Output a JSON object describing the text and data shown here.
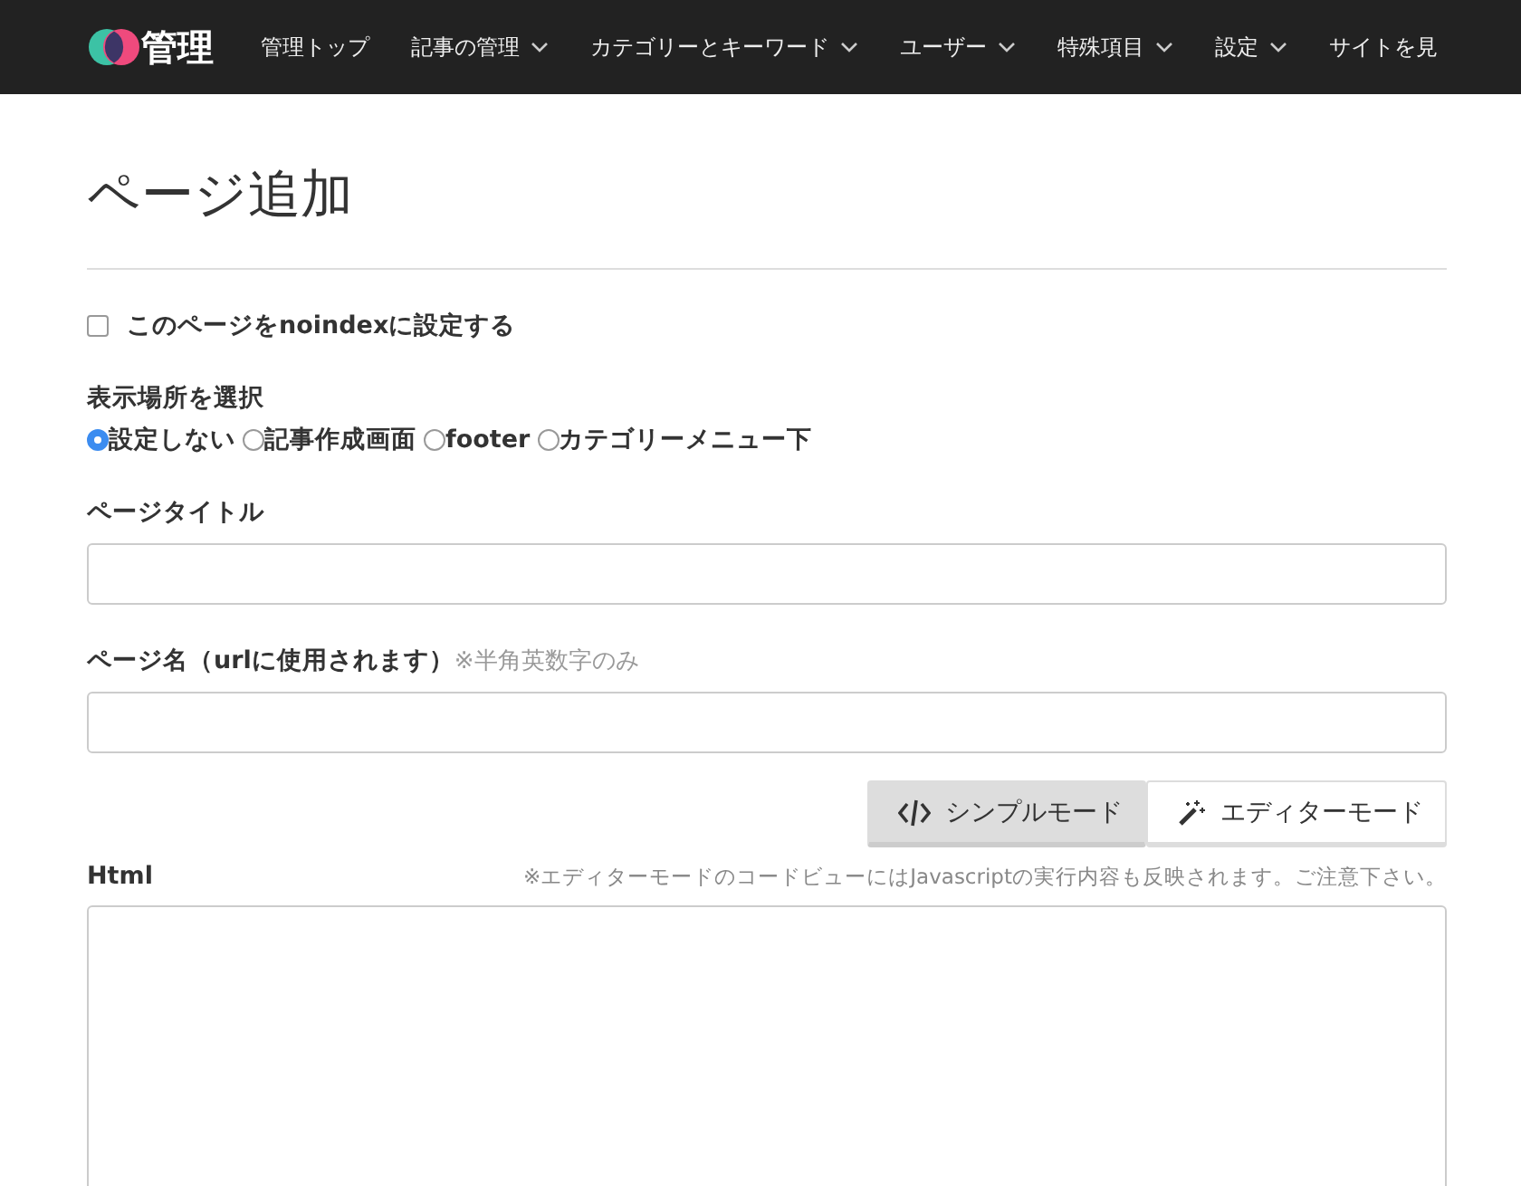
{
  "nav": {
    "logo": "管理",
    "items": [
      {
        "label": "管理トップ",
        "dropdown": false
      },
      {
        "label": "記事の管理",
        "dropdown": true
      },
      {
        "label": "カテゴリーとキーワード",
        "dropdown": true
      },
      {
        "label": "ユーザー",
        "dropdown": true
      },
      {
        "label": "特殊項目",
        "dropdown": true
      },
      {
        "label": "設定",
        "dropdown": true
      },
      {
        "label": "サイトを見",
        "dropdown": false
      }
    ]
  },
  "title": "ページ追加",
  "noindex": {
    "label": "このページをnoindexに設定する",
    "checked": false
  },
  "placement": {
    "label": "表示場所を選択",
    "options": [
      {
        "label": "設定しない",
        "selected": true
      },
      {
        "label": "記事作成画面",
        "selected": false
      },
      {
        "label": "footer",
        "selected": false
      },
      {
        "label": "カテゴリーメニュー下",
        "selected": false
      }
    ]
  },
  "page_title": {
    "label": "ページタイトル"
  },
  "page_name": {
    "label": "ページ名（urlに使用されます）",
    "hint": "※半角英数字のみ"
  },
  "modes": [
    {
      "kind": "code",
      "label": "シンプルモード",
      "selected": true
    },
    {
      "kind": "wand",
      "label": "エディターモード",
      "selected": false
    }
  ],
  "html": {
    "label": "Html",
    "note": "※エディターモードのコードビューにはJavascriptの実行内容も反映されます。ご注意下さい。"
  }
}
